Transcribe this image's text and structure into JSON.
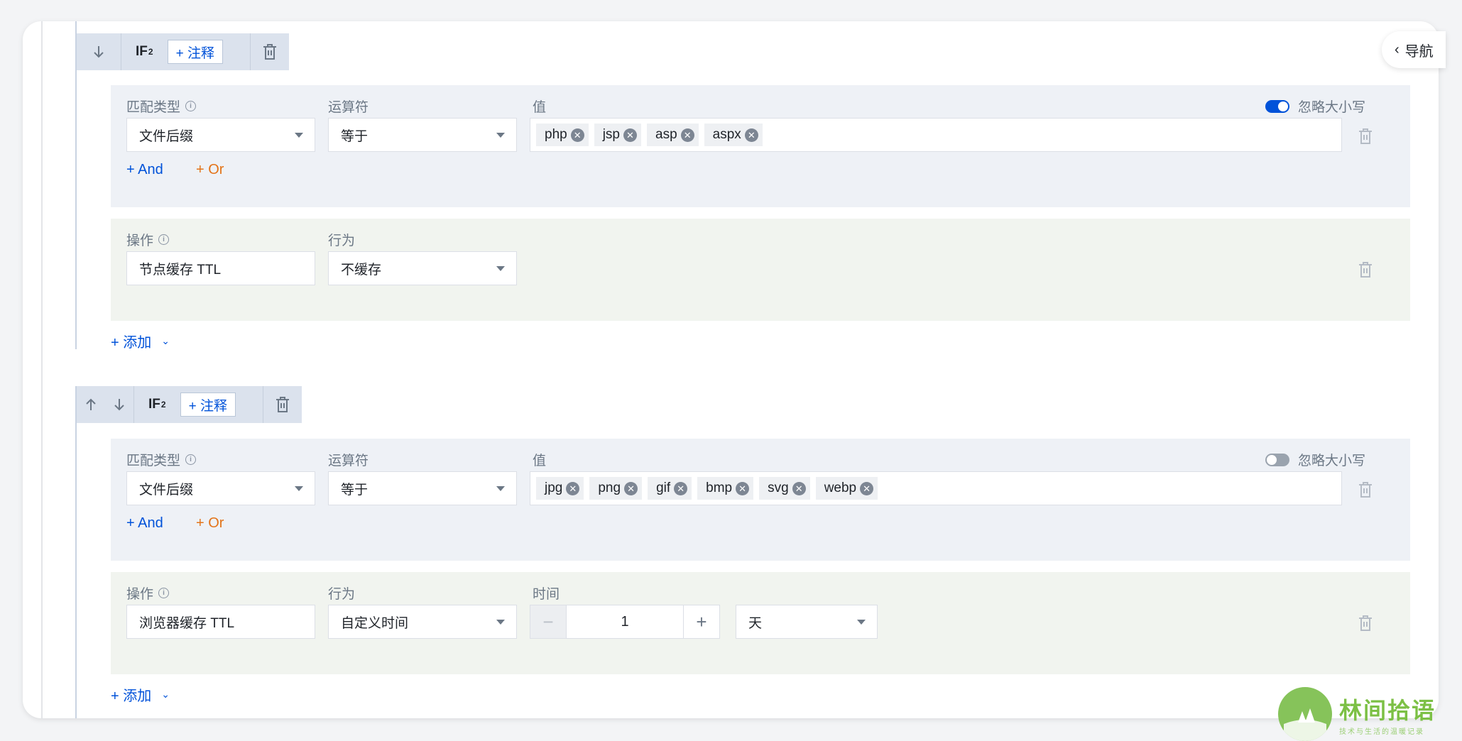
{
  "nav_label": "导航",
  "rules": [
    {
      "if_label": "IF",
      "if_sub": "2",
      "note_label": "+ 注释",
      "show_up_arrow": false,
      "condition": {
        "match_type_label": "匹配类型",
        "match_type_value": "文件后缀",
        "operator_label": "运算符",
        "operator_value": "等于",
        "value_label": "值",
        "ignore_case_label": "忽略大小写",
        "ignore_case_on": true,
        "tags": [
          "php",
          "jsp",
          "asp",
          "aspx"
        ],
        "and_label": "+ And",
        "or_label": "+ Or"
      },
      "action": {
        "operation_label": "操作",
        "operation_value": "节点缓存 TTL",
        "behavior_label": "行为",
        "behavior_value": "不缓存"
      },
      "add_label": "+ 添加"
    },
    {
      "if_label": "IF",
      "if_sub": "2",
      "note_label": "+ 注释",
      "show_up_arrow": true,
      "condition": {
        "match_type_label": "匹配类型",
        "match_type_value": "文件后缀",
        "operator_label": "运算符",
        "operator_value": "等于",
        "value_label": "值",
        "ignore_case_label": "忽略大小写",
        "ignore_case_on": false,
        "tags": [
          "jpg",
          "png",
          "gif",
          "bmp",
          "svg",
          "webp"
        ],
        "and_label": "+ And",
        "or_label": "+ Or"
      },
      "action": {
        "operation_label": "操作",
        "operation_value": "浏览器缓存 TTL",
        "behavior_label": "行为",
        "behavior_value": "自定义时间",
        "time_label": "时间",
        "time_value": "1",
        "time_unit": "天"
      },
      "add_label": "+ 添加"
    }
  ],
  "watermark": {
    "title": "林间拾语",
    "subtitle": "技术与生活的温暖记录"
  },
  "colors": {
    "accent": "#0052d9",
    "or": "#e37318",
    "condition_bg": "#eef1f6",
    "action_bg": "#f1f4ef",
    "header_bg": "#dbe2ed"
  }
}
